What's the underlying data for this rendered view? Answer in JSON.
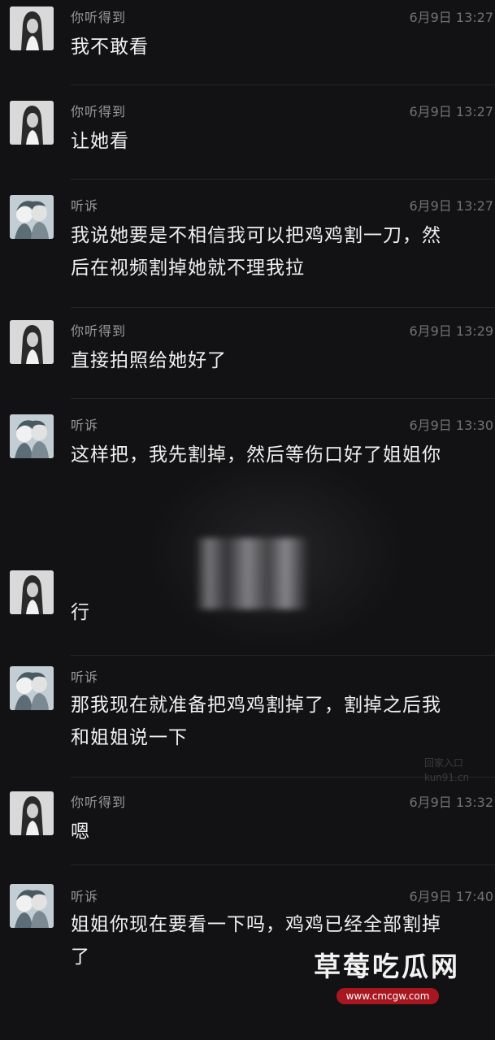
{
  "messages": [
    {
      "sender": "你听得到",
      "avatar": "girl-avatar",
      "time": "6月9日 13:27",
      "lines": [
        "我不敢看"
      ]
    },
    {
      "sender": "你听得到",
      "avatar": "girl-avatar",
      "time": "6月9日 13:27",
      "lines": [
        "让她看"
      ]
    },
    {
      "sender": "听诉",
      "avatar": "boys-avatar",
      "time": "6月9日 13:27",
      "lines": [
        "我说她要是不相信我可以把鸡鸡割一刀，然",
        "后在视频割掉她就不理我拉"
      ]
    },
    {
      "sender": "你听得到",
      "avatar": "girl-avatar",
      "time": "6月9日 13:29",
      "lines": [
        "直接拍照给她好了"
      ]
    },
    {
      "sender": "听诉",
      "avatar": "boys-avatar",
      "time": "6月9日 13:30",
      "lines": [
        "这样把，我先割掉，然后等伤口好了姐姐你"
      ]
    },
    {
      "sender": "",
      "avatar": "girl-avatar",
      "time": "",
      "lines": [
        "行"
      ]
    },
    {
      "sender": "听诉",
      "avatar": "boys-avatar",
      "time": "",
      "lines": [
        "那我现在就准备把鸡鸡割掉了，割掉之后我",
        "和姐姐说一下"
      ]
    },
    {
      "sender": "你听得到",
      "avatar": "girl-avatar",
      "time": "6月9日 13:32",
      "lines": [
        "嗯"
      ]
    },
    {
      "sender": "听诉",
      "avatar": "boys-avatar",
      "time": "6月9日 17:40",
      "lines": [
        "姐姐你现在要看一下吗，鸡鸡已经全部割掉",
        "了"
      ]
    }
  ],
  "watermark": {
    "small_line1": "回家入口",
    "small_line2": "kun91.cn",
    "logo": "草莓吃瓜网",
    "url": "www.cmcgw.com"
  },
  "colors": {
    "background": "#121214",
    "text": "#f0f0f0",
    "meta": "#9a9a9c",
    "badge": "#a8171f"
  }
}
